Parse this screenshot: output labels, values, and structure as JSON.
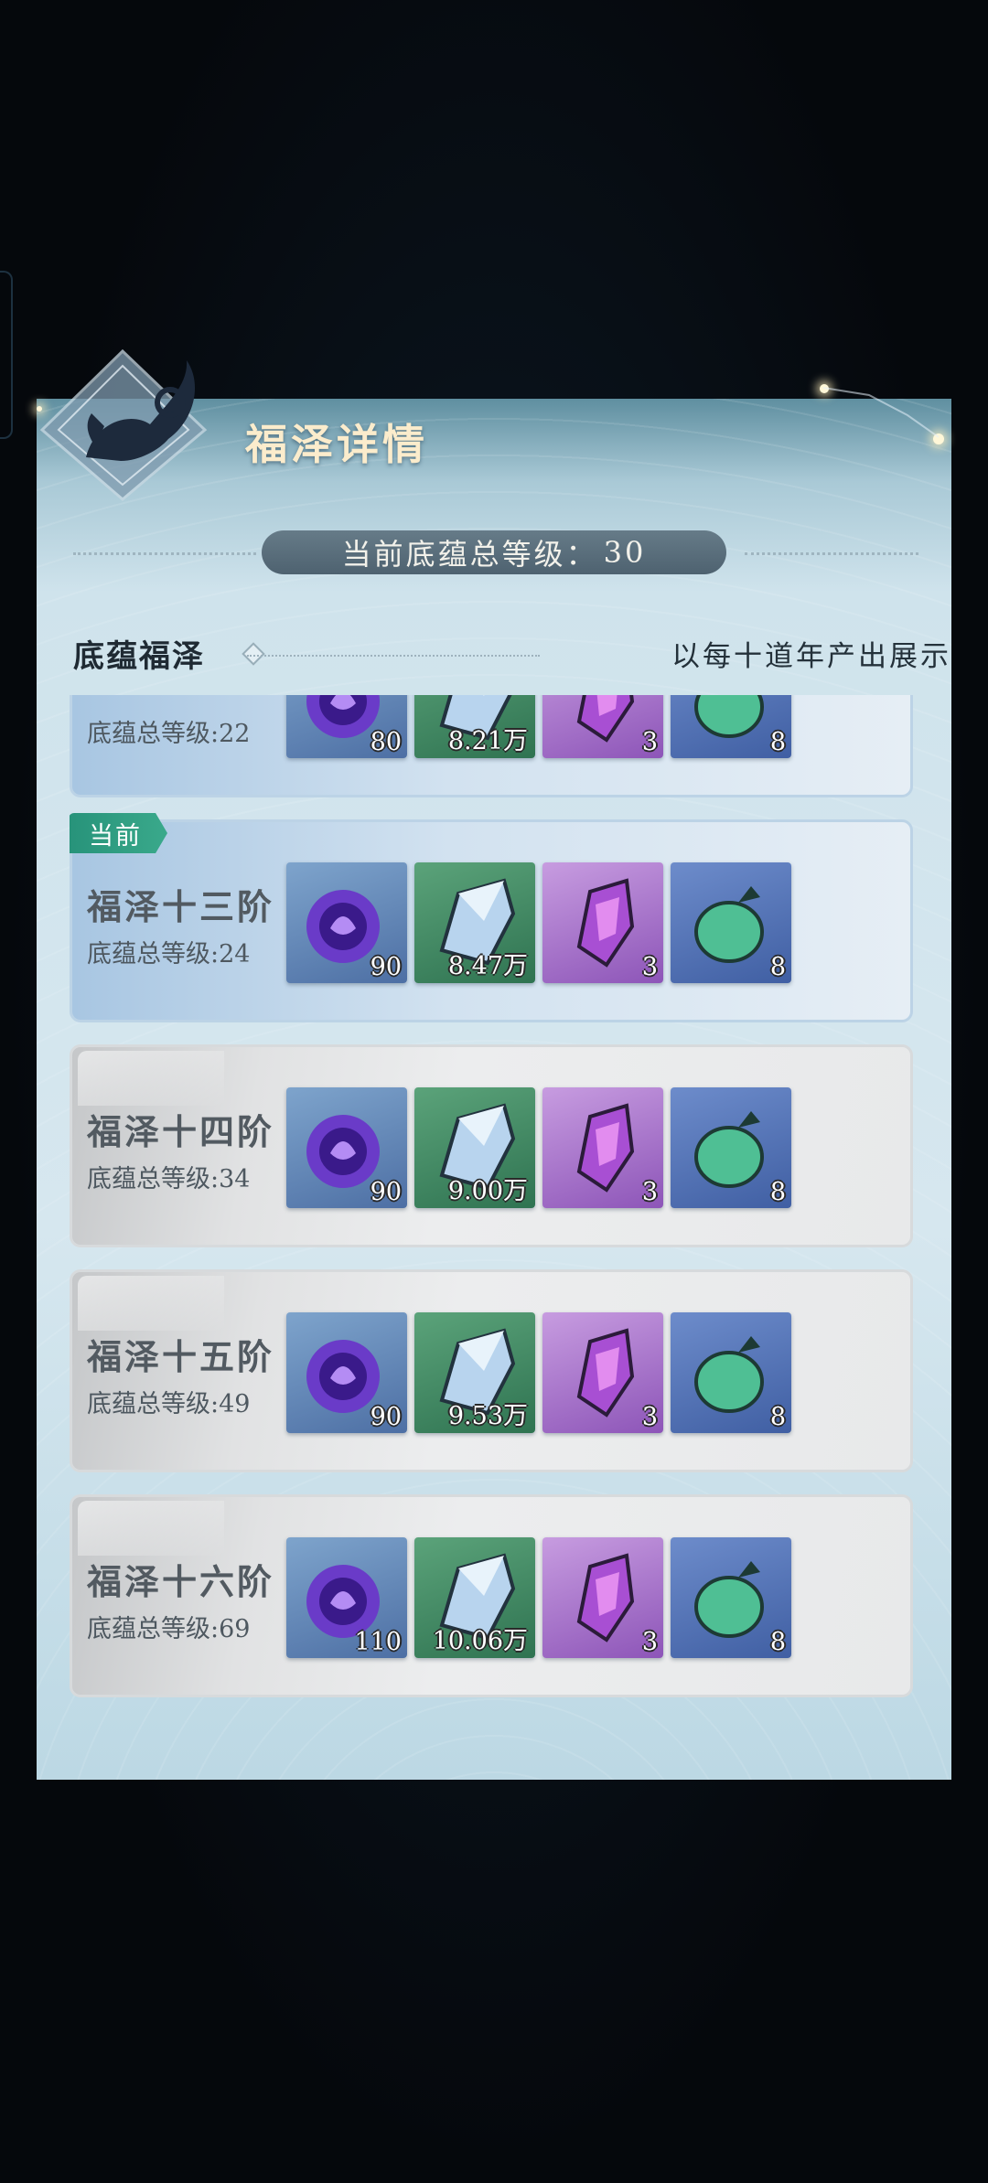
{
  "header": {
    "title": "福泽详情"
  },
  "summary": {
    "label": "当前底蕴总等级：",
    "value": "30"
  },
  "section": {
    "label": "底蕴福泽",
    "note": "以每十道年产出展示"
  },
  "tiers": [
    {
      "name": "",
      "level_text": "底蕴总等级:22",
      "current": false,
      "rewards": [
        "80",
        "8.21万",
        "3",
        "8"
      ]
    },
    {
      "name": "福泽十三阶",
      "level_text": "底蕴总等级:24",
      "current": true,
      "rewards": [
        "90",
        "8.47万",
        "3",
        "8"
      ]
    },
    {
      "name": "福泽十四阶",
      "level_text": "底蕴总等级:34",
      "current": false,
      "rewards": [
        "90",
        "9.00万",
        "3",
        "8"
      ]
    },
    {
      "name": "福泽十五阶",
      "level_text": "底蕴总等级:49",
      "current": false,
      "rewards": [
        "90",
        "9.53万",
        "3",
        "8"
      ]
    },
    {
      "name": "福泽十六阶",
      "level_text": "底蕴总等级:69",
      "current": false,
      "rewards": [
        "110",
        "10.06万",
        "3",
        "8"
      ]
    }
  ],
  "current_badge": "当前",
  "icons": [
    "spirit-orb-icon",
    "crystal-shard-icon",
    "purple-gem-icon",
    "jade-pouch-icon"
  ],
  "colors": {
    "accent_green": "#2f9c7f",
    "title_gold": "#fbeccc",
    "pill_bg": "#5a6e7b"
  }
}
